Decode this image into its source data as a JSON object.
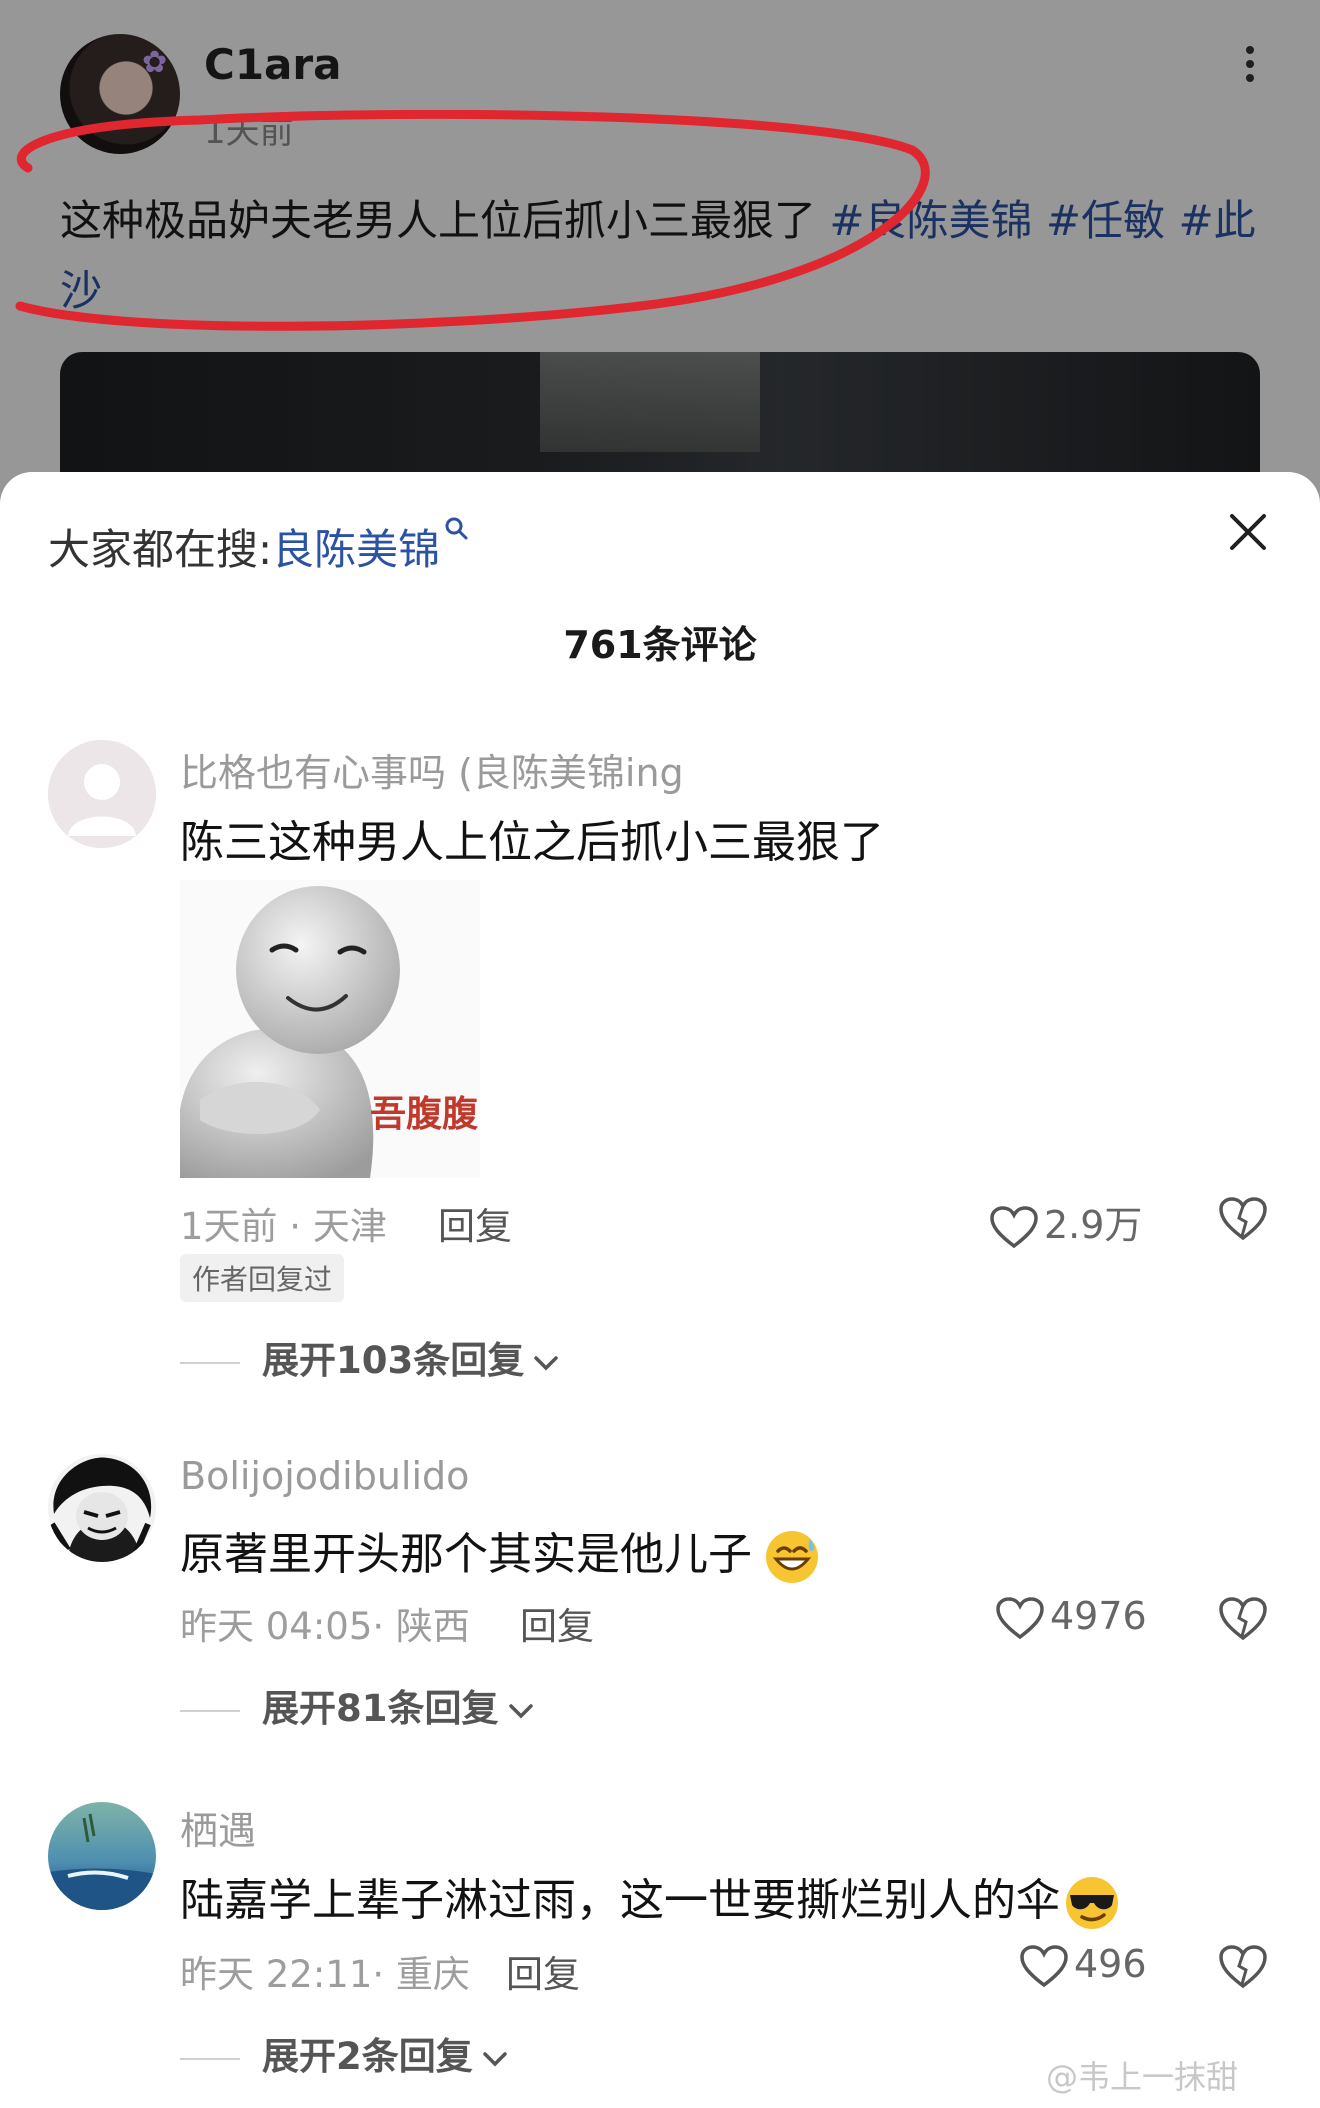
{
  "post": {
    "author": "C1ara",
    "time": "1天前",
    "text": "这种极品妒夫老男人上位后抓小三最狠了 ",
    "tags": [
      "#良陈美锦",
      "#任敏",
      "#此沙"
    ]
  },
  "sheet": {
    "trending_prefix": "大家都在搜:",
    "trending_term": "良陈美锦",
    "comment_count": "761条评论"
  },
  "comments": [
    {
      "user": "比格也有心事吗 (良陈美锦ing",
      "text": "陈三这种男人上位之后抓小三最狠了",
      "sticker_text": "吾腹腹",
      "meta": "1天前 · 天津",
      "reply": "回复",
      "likes": "2.9万",
      "badge": "作者回复过",
      "expand": "展开103条回复"
    },
    {
      "user": "Bolijojodibulido",
      "text": "原著里开头那个其实是他儿子",
      "emoji": "grinning-sweat-emoji",
      "meta": "昨天 04:05· 陕西",
      "reply": "回复",
      "likes": "4976",
      "expand": "展开81条回复"
    },
    {
      "user": "栖遇",
      "text": "陆嘉学上辈子淋过雨，这一世要撕烂别人的伞",
      "emoji": "sunglasses-emoji",
      "meta": "昨天 22:11· 重庆",
      "reply": "回复",
      "likes": "496",
      "expand": "展开2条回复"
    }
  ],
  "watermark": "@韦上一抹甜",
  "colors": {
    "link": "#2b52a3",
    "annotation_red": "#e0262f",
    "muted": "#9d9d9d"
  }
}
